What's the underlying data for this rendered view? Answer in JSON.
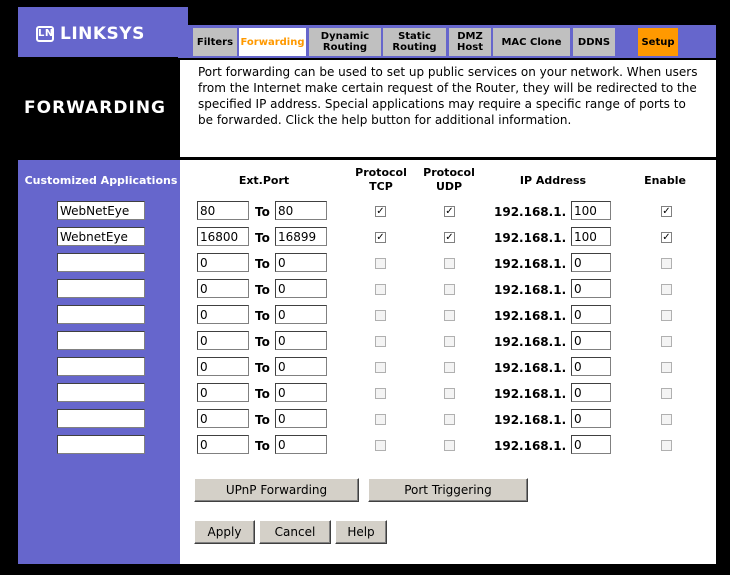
{
  "brand": {
    "name": "LINKSYS",
    "logo_mark": "LN"
  },
  "tabs": [
    {
      "label": "Filters",
      "active": false
    },
    {
      "label": "Forwarding",
      "active": true
    },
    {
      "label": "Dynamic Routing",
      "active": false
    },
    {
      "label": "Static Routing",
      "active": false
    },
    {
      "label": "DMZ Host",
      "active": false
    },
    {
      "label": "MAC Clone",
      "active": false
    },
    {
      "label": "DDNS",
      "active": false
    },
    {
      "label": "Setup",
      "active": false
    }
  ],
  "page": {
    "title": "FORWARDING",
    "description": "Port forwarding can be used to set up public services on your network. When users from the Internet make certain request of the Router, they will be redirected to the specified IP address. Special applications may require a specific range of ports to be forwarded. Click the help button for additional information."
  },
  "table": {
    "headers": {
      "custom_apps": "Customized Applications",
      "ext_port": "Ext.Port",
      "protocol_tcp_1": "Protocol",
      "protocol_tcp_2": "TCP",
      "protocol_udp_1": "Protocol",
      "protocol_udp_2": "UDP",
      "ip_address": "IP Address",
      "enable": "Enable"
    },
    "to_label": "To",
    "ip_prefix": "192.168.1.",
    "rows": [
      {
        "name": "WebNetEye",
        "from": "80",
        "to": "80",
        "tcp": true,
        "udp": true,
        "ip": "100",
        "enable": true
      },
      {
        "name": "WebnetEye",
        "from": "16800",
        "to": "16899",
        "tcp": true,
        "udp": true,
        "ip": "100",
        "enable": true
      },
      {
        "name": "",
        "from": "0",
        "to": "0",
        "tcp": false,
        "udp": false,
        "ip": "0",
        "enable": false
      },
      {
        "name": "",
        "from": "0",
        "to": "0",
        "tcp": false,
        "udp": false,
        "ip": "0",
        "enable": false
      },
      {
        "name": "",
        "from": "0",
        "to": "0",
        "tcp": false,
        "udp": false,
        "ip": "0",
        "enable": false
      },
      {
        "name": "",
        "from": "0",
        "to": "0",
        "tcp": false,
        "udp": false,
        "ip": "0",
        "enable": false
      },
      {
        "name": "",
        "from": "0",
        "to": "0",
        "tcp": false,
        "udp": false,
        "ip": "0",
        "enable": false
      },
      {
        "name": "",
        "from": "0",
        "to": "0",
        "tcp": false,
        "udp": false,
        "ip": "0",
        "enable": false
      },
      {
        "name": "",
        "from": "0",
        "to": "0",
        "tcp": false,
        "udp": false,
        "ip": "0",
        "enable": false
      },
      {
        "name": "",
        "from": "0",
        "to": "0",
        "tcp": false,
        "udp": false,
        "ip": "0",
        "enable": false
      }
    ]
  },
  "buttons": {
    "upnp": "UPnP Forwarding",
    "port_triggering": "Port Triggering",
    "apply": "Apply",
    "cancel": "Cancel",
    "help": "Help"
  },
  "colors": {
    "accent": "#6666cc",
    "active_tab_text": "#ff9900",
    "setup_tab": "#ff9900"
  }
}
